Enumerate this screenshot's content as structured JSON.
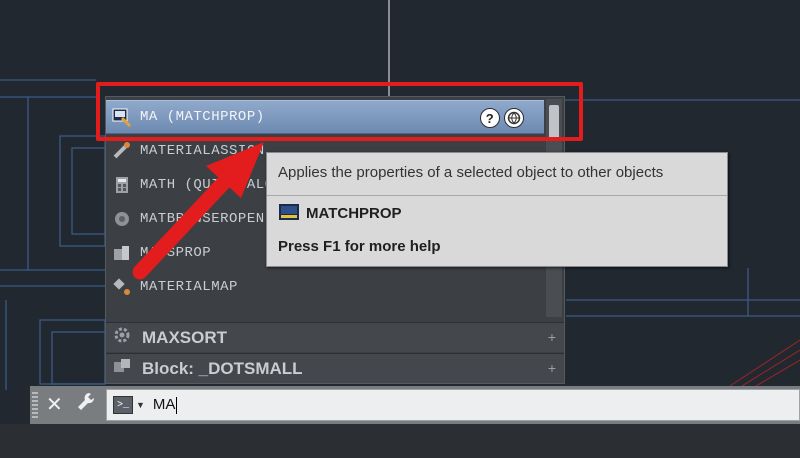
{
  "colors": {
    "model_background": "#212830",
    "highlight": "#e31d1d",
    "selection": "#7e98bd",
    "tooltip_background": "#d9d9d9"
  },
  "autocomplete": {
    "items": [
      {
        "label": "MA (MATCHPROP)",
        "icon": "matchprop-icon",
        "selected": true
      },
      {
        "label": "MATERIALASSIGN",
        "icon": "material-assign-icon",
        "selected": false
      },
      {
        "label": "MATH (QUICKCALC)",
        "icon": "calculator-icon",
        "selected": false
      },
      {
        "label": "MATBROWSEROPEN",
        "icon": "material-browser-icon",
        "selected": false
      },
      {
        "label": "MASSPROP",
        "icon": "massprop-icon",
        "selected": false
      },
      {
        "label": "MATERIALMAP",
        "icon": "material-map-icon",
        "selected": false
      }
    ],
    "groups": [
      {
        "label": "MAXSORT",
        "icon": "gear-icon"
      },
      {
        "label": "Block: _DOTSMALL",
        "icon": "block-icon"
      }
    ],
    "help_icon_glyph": "?"
  },
  "tooltip": {
    "description": "Applies the properties of a selected object to other objects",
    "command_name": "MATCHPROP",
    "help_hint": "Press F1 for more help"
  },
  "command_line": {
    "close_glyph": "✕",
    "input_value": "MA",
    "prompt_glyph": ">_"
  }
}
